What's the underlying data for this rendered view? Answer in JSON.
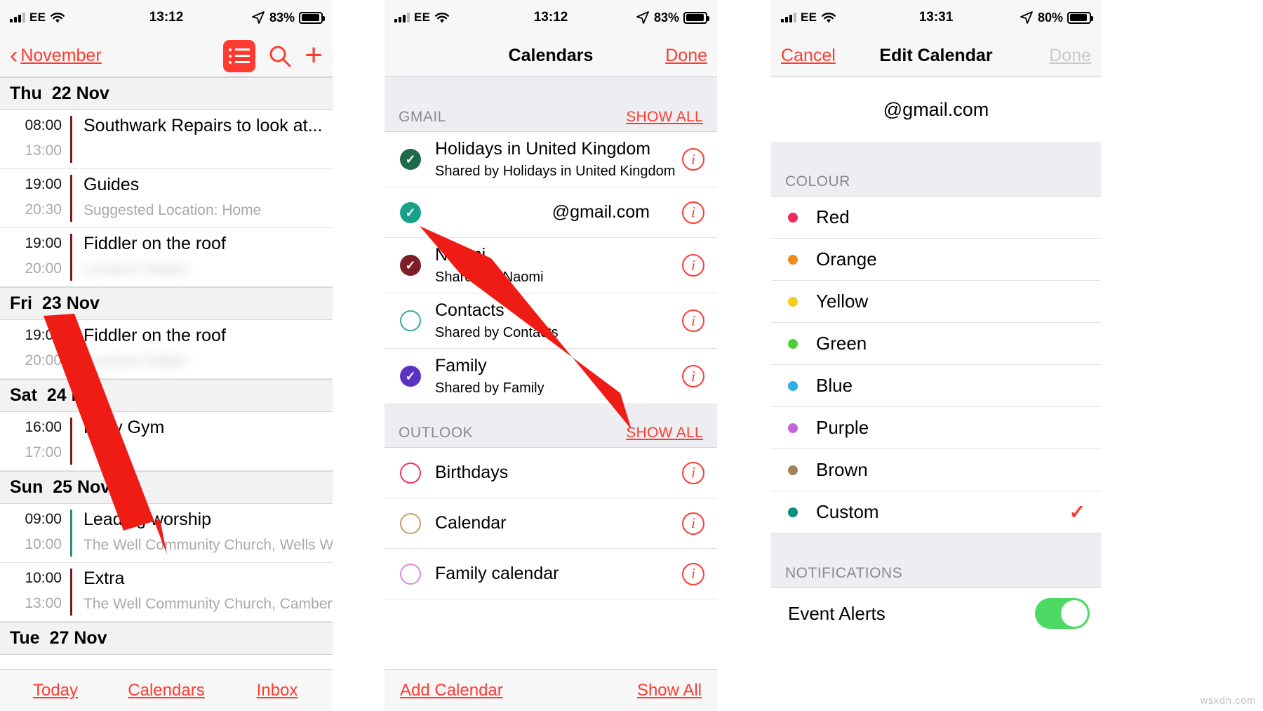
{
  "colors": {
    "accent": "#ff3b30",
    "section_bg": "#eeeef2",
    "nav_bg": "#f7f7f7"
  },
  "panel_agenda": {
    "status": {
      "carrier": "EE",
      "time": "13:12",
      "battery_pct": "83%",
      "location_icon": "location-arrow",
      "wifi_icon": "wifi"
    },
    "nav": {
      "back_label": "November",
      "list_icon": "list-view-icon",
      "search_icon": "search-icon",
      "add_icon": "plus-icon"
    },
    "days": [
      {
        "header_day": "Thu",
        "header_date": "22 Nov",
        "events": [
          {
            "start": "08:00",
            "end": "13:00",
            "title": "Southwark Repairs to look at...",
            "subtitle": "",
            "bar_color": "#7b1a1a",
            "blurred": false
          },
          {
            "start": "19:00",
            "end": "20:30",
            "title": "Guides",
            "subtitle": "Suggested Location: Home",
            "bar_color": "#7b1a1a",
            "blurred": false
          },
          {
            "start": "19:00",
            "end": "20:00",
            "title": "Fiddler on the roof",
            "subtitle": "Location hidden",
            "bar_color": "#7b1a1a",
            "blurred": true
          }
        ]
      },
      {
        "header_day": "Fri",
        "header_date": "23 Nov",
        "events": [
          {
            "start": "19:00",
            "end": "20:00",
            "title": "Fiddler on the roof",
            "subtitle": "Location hidden",
            "bar_color": "#7b1a1a",
            "blurred": true
          }
        ]
      },
      {
        "header_day": "Sat",
        "header_date": "24 Nov",
        "events": [
          {
            "start": "16:00",
            "end": "17:00",
            "title": "Holly Gym",
            "subtitle": "",
            "bar_color": "#7b1a1a",
            "blurred": false
          }
        ]
      },
      {
        "header_day": "Sun",
        "header_date": "25 Nov",
        "events": [
          {
            "start": "09:00",
            "end": "10:00",
            "title": "Leading worship",
            "subtitle": "The Well Community Church, Wells Wa...",
            "bar_color": "#2a8c82",
            "blurred": false
          },
          {
            "start": "10:00",
            "end": "13:00",
            "title": "Extra",
            "subtitle": "The Well Community Church, Camberw...",
            "bar_color": "#7b1a1a",
            "blurred": false
          }
        ]
      },
      {
        "header_day": "Tue",
        "header_date": "27 Nov",
        "events": []
      }
    ],
    "tabs": [
      {
        "label": "Today",
        "name": "tab-today"
      },
      {
        "label": "Calendars",
        "name": "tab-calendars"
      },
      {
        "label": "Inbox",
        "name": "tab-inbox"
      }
    ]
  },
  "panel_calendars": {
    "status": {
      "carrier": "EE",
      "time": "13:12",
      "battery_pct": "83%"
    },
    "nav": {
      "title": "Calendars",
      "done_label": "Done"
    },
    "sections": [
      {
        "label": "GMAIL",
        "action": "SHOW ALL",
        "items": [
          {
            "name": "Holidays in United Kingdom",
            "subtitle": "Shared by Holidays in United Kingdom",
            "color": "#1d6b4a",
            "checked": true,
            "align_right": false
          },
          {
            "name": "@gmail.com",
            "subtitle": "",
            "color": "#19a08a",
            "checked": true,
            "align_right": true
          },
          {
            "name": "Naomi",
            "subtitle": "Shared by Naomi",
            "color": "#7d1f26",
            "checked": true,
            "align_right": false
          },
          {
            "name": "Contacts",
            "subtitle": "Shared by Contacts",
            "color": "#3aa89b",
            "checked": false,
            "align_right": false
          },
          {
            "name": "Family",
            "subtitle": "Shared by Family",
            "color": "#5a34c0",
            "checked": true,
            "align_right": false
          }
        ]
      },
      {
        "label": "OUTLOOK",
        "action": "SHOW ALL",
        "items": [
          {
            "name": "Birthdays",
            "subtitle": "",
            "color": "#f0326a",
            "checked": false,
            "align_right": false
          },
          {
            "name": "Calendar",
            "subtitle": "",
            "color": "#c9a063",
            "checked": false,
            "align_right": false
          },
          {
            "name": "Family calendar",
            "subtitle": "",
            "color": "#d98ad9",
            "checked": false,
            "align_right": false
          }
        ]
      }
    ],
    "footer": {
      "add_label": "Add Calendar",
      "show_all_label": "Show All"
    }
  },
  "panel_edit": {
    "status": {
      "carrier": "EE",
      "time": "13:31",
      "battery_pct": "80%"
    },
    "nav": {
      "cancel_label": "Cancel",
      "title": "Edit Calendar",
      "done_label": "Done"
    },
    "account": "@gmail.com",
    "colour_section_label": "COLOUR",
    "colours": [
      {
        "label": "Red",
        "hex": "#f2295b",
        "selected": false
      },
      {
        "label": "Orange",
        "hex": "#f08a1e",
        "selected": false
      },
      {
        "label": "Yellow",
        "hex": "#f7cb1a",
        "selected": false
      },
      {
        "label": "Green",
        "hex": "#4cd037",
        "selected": false
      },
      {
        "label": "Blue",
        "hex": "#32ade6",
        "selected": false
      },
      {
        "label": "Purple",
        "hex": "#c164d8",
        "selected": false
      },
      {
        "label": "Brown",
        "hex": "#a1845e",
        "selected": false
      },
      {
        "label": "Custom",
        "hex": "#0a8f80",
        "selected": true
      }
    ],
    "selected_check": "✓",
    "notifications_section_label": "NOTIFICATIONS",
    "event_alerts_label": "Event Alerts",
    "event_alerts_on": true
  },
  "watermark": "wsxdn.com"
}
